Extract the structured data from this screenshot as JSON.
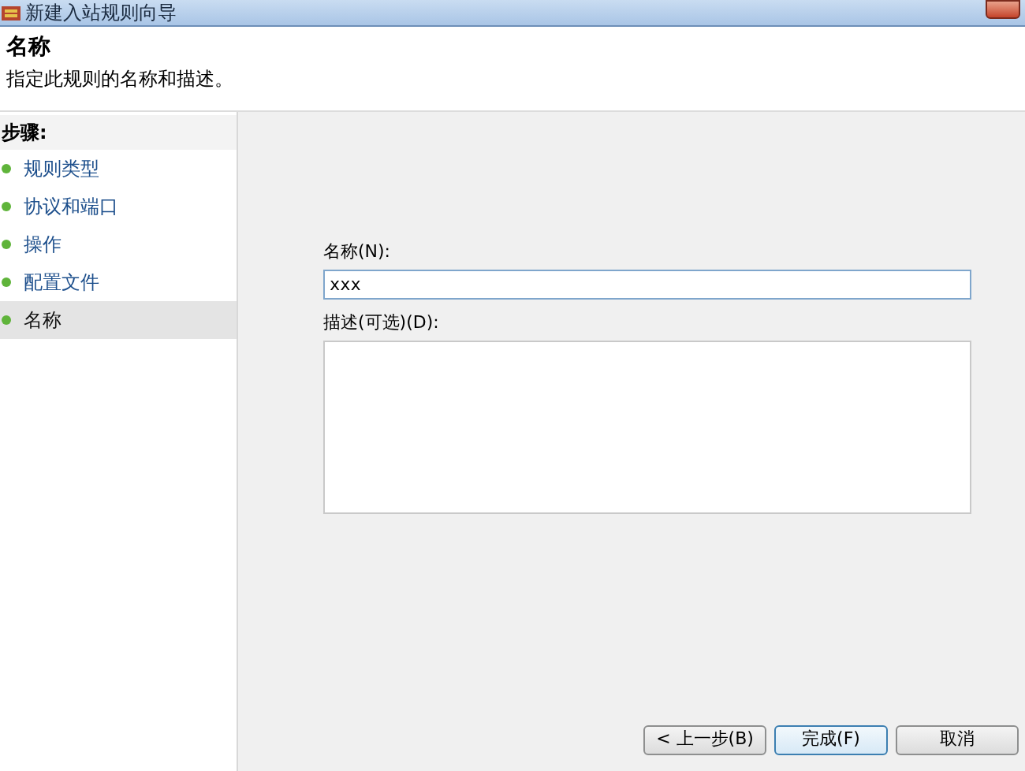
{
  "window": {
    "title": "新建入站规则向导"
  },
  "header": {
    "title": "名称",
    "subtitle": "指定此规则的名称和描述。"
  },
  "steps": {
    "heading": "步骤:",
    "items": [
      {
        "label": "规则类型",
        "selected": false
      },
      {
        "label": "协议和端口",
        "selected": false
      },
      {
        "label": "操作",
        "selected": false
      },
      {
        "label": "配置文件",
        "selected": false
      },
      {
        "label": "名称",
        "selected": true
      }
    ]
  },
  "form": {
    "name_label": "名称(N):",
    "name_value": "xxx",
    "description_label": "描述(可选)(D):"
  },
  "buttons": [
    {
      "label": "< 上一步(B)",
      "default": false
    },
    {
      "label": "完成(F)",
      "default": true
    },
    {
      "label": "取消",
      "default": false
    }
  ]
}
